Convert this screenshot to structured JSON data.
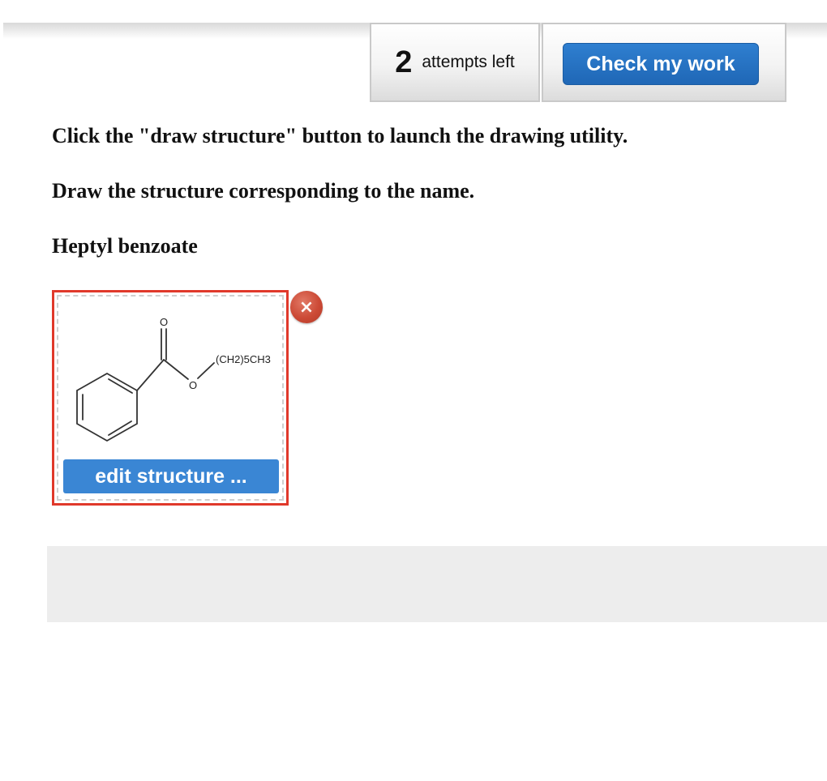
{
  "header": {
    "attempts_count": "2",
    "attempts_label": "attempts left",
    "check_button_label": "Check my work"
  },
  "instructions": [
    "Click the \"draw structure\" button to launch the drawing utility.",
    "Draw the structure corresponding to the name.",
    "Heptyl benzoate"
  ],
  "structure": {
    "carbonyl_oxygen": "O",
    "ester_oxygen": "O",
    "chain_label": "(CH2)5CH3",
    "edit_button_label": "edit structure ...",
    "remove_icon": "×"
  },
  "colors": {
    "accent_blue": "#2f7fd0",
    "edit_blue": "#3a86d4",
    "selection_red": "#e0392b",
    "remove_red": "#cc4a36"
  }
}
